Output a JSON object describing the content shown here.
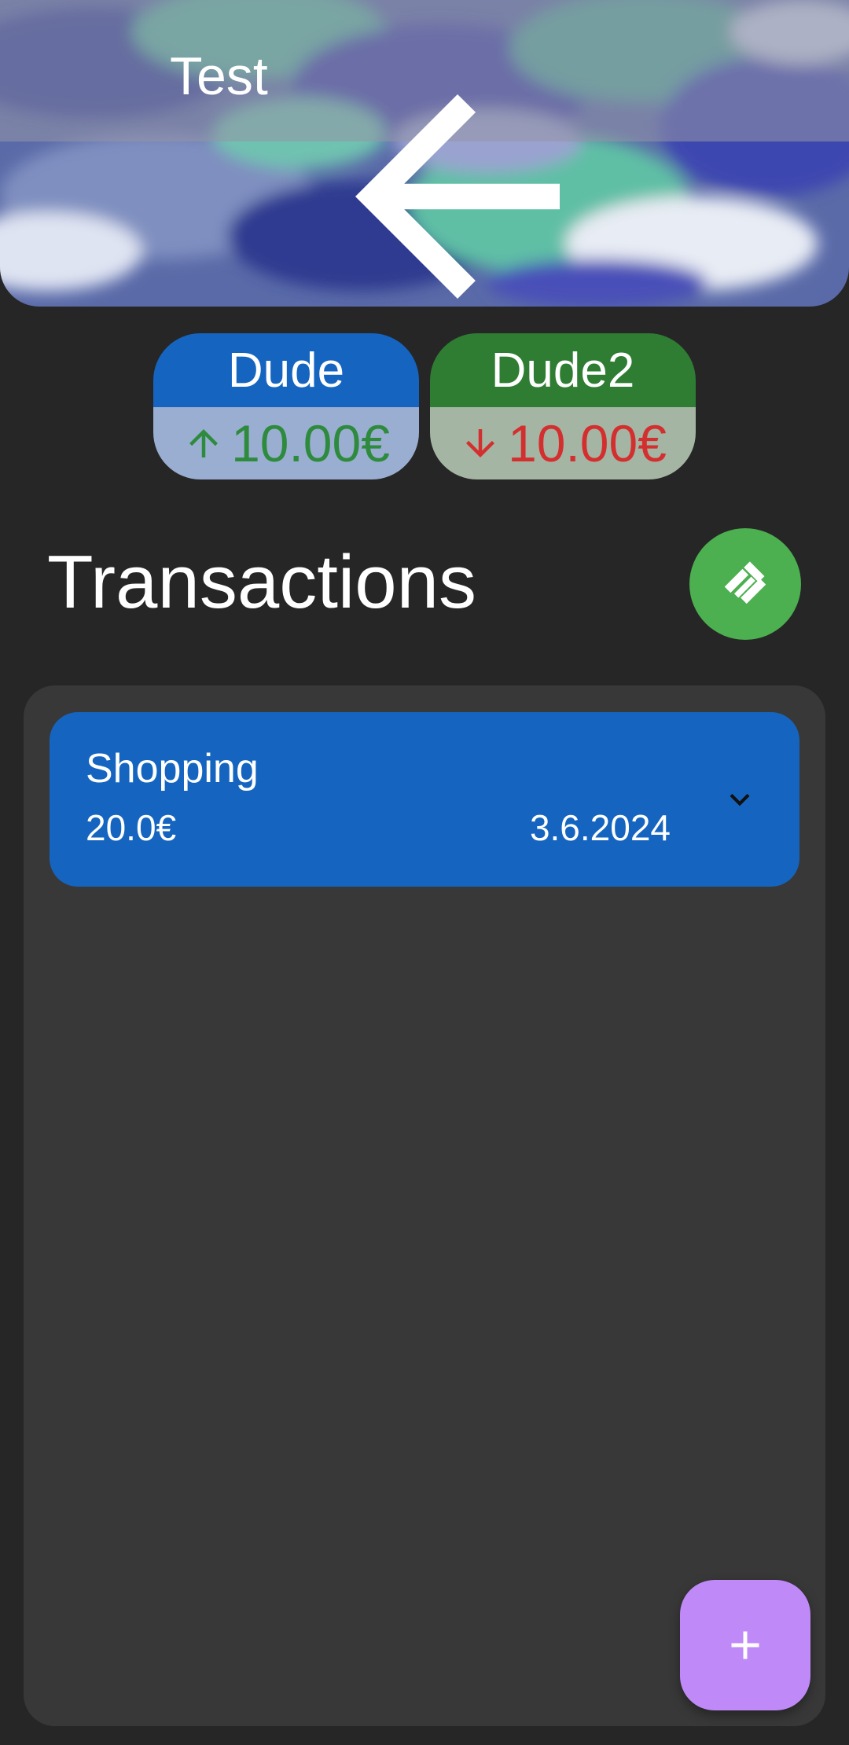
{
  "appbar": {
    "title": "Test",
    "back_icon": "arrow-back-icon",
    "share_icon": "share-icon"
  },
  "balances": [
    {
      "name": "Dude",
      "amount": "10.00€",
      "direction": "up",
      "header_color": "#1565c0",
      "amount_color": "#2e8b3d"
    },
    {
      "name": "Dude2",
      "amount": "10.00€",
      "direction": "down",
      "header_color": "#2e7d32",
      "amount_color": "#d32f2f"
    }
  ],
  "transactions_section": {
    "title": "Transactions",
    "settle_icon": "handshake-icon"
  },
  "transactions": [
    {
      "title": "Shopping",
      "amount": "20.0€",
      "date": "3.6.2024",
      "expand_icon": "chevron-down-icon"
    }
  ],
  "fab": {
    "icon": "add-icon",
    "color": "#bf8af8"
  }
}
